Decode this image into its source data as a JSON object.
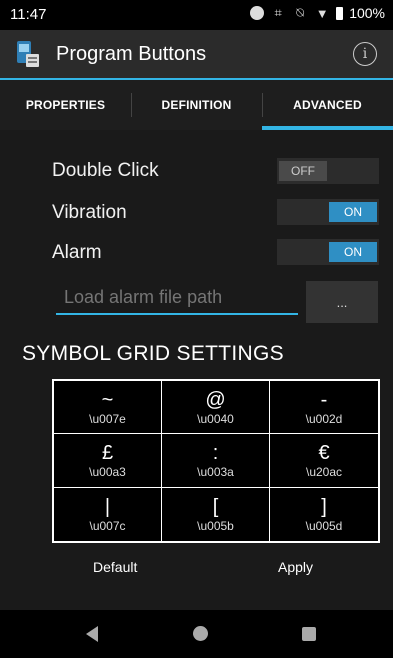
{
  "status_bar": {
    "time": "11:47",
    "battery": "100%"
  },
  "app_bar": {
    "title": "Program Buttons"
  },
  "tabs": [
    {
      "label": "PROPERTIES"
    },
    {
      "label": "DEFINITION"
    },
    {
      "label": "ADVANCED"
    }
  ],
  "settings": {
    "double_click": {
      "label": "Double Click",
      "state": "OFF"
    },
    "vibration": {
      "label": "Vibration",
      "state": "ON"
    },
    "alarm": {
      "label": "Alarm",
      "state": "ON"
    },
    "alarm_path": {
      "placeholder": "Load alarm file path",
      "value": ""
    },
    "browse_label": "..."
  },
  "symbol_grid": {
    "title": "SYMBOL GRID SETTINGS",
    "cells": [
      {
        "symbol": "~",
        "code": "\\u007e"
      },
      {
        "symbol": "@",
        "code": "\\u0040"
      },
      {
        "symbol": "-",
        "code": "\\u002d"
      },
      {
        "symbol": "£",
        "code": "\\u00a3"
      },
      {
        "symbol": ":",
        "code": "\\u003a"
      },
      {
        "symbol": "€",
        "code": "\\u20ac"
      },
      {
        "symbol": "|",
        "code": "\\u007c"
      },
      {
        "symbol": "[",
        "code": "\\u005b"
      },
      {
        "symbol": "]",
        "code": "\\u005d"
      }
    ]
  },
  "actions": {
    "default_label": "Default",
    "apply_label": "Apply"
  },
  "colors": {
    "accent": "#33b5e5",
    "toggle_on": "#2f8fc4"
  }
}
